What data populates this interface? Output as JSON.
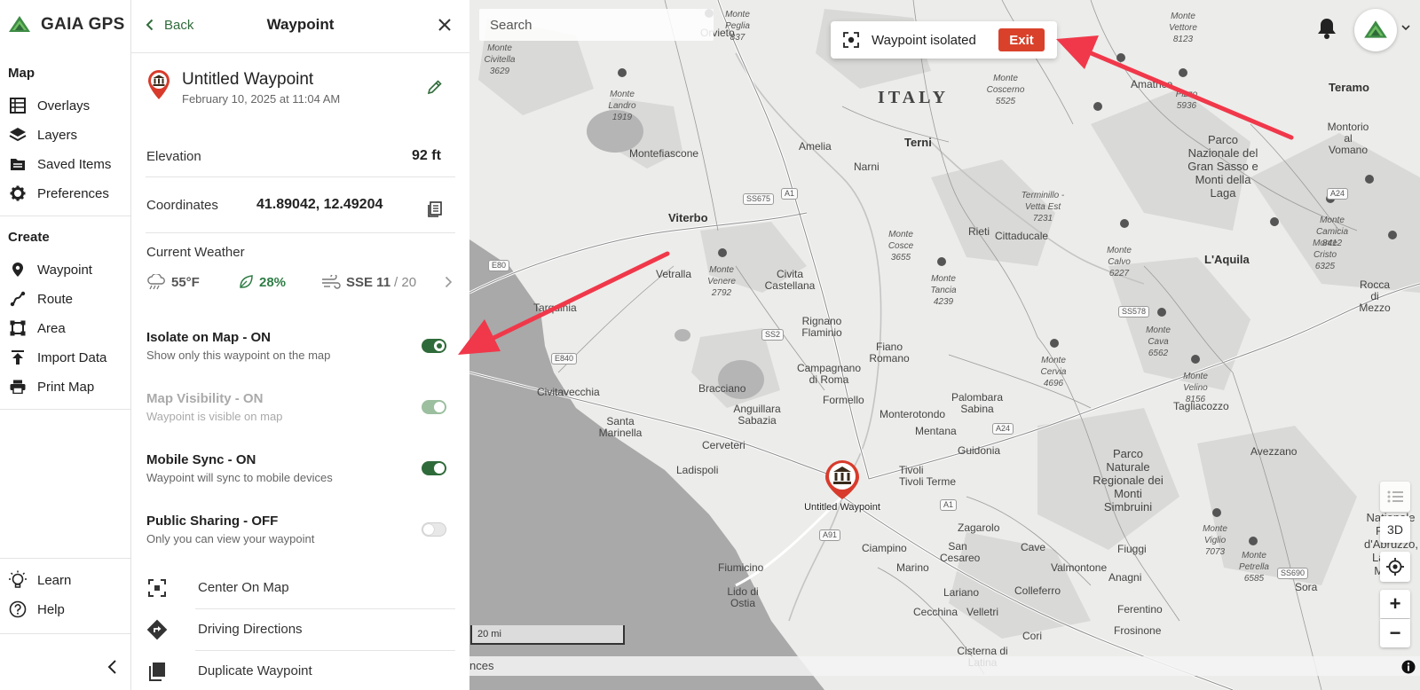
{
  "nav": {
    "brand": "GAIA GPS",
    "map_title": "Map",
    "map_items": [
      {
        "label": "Overlays",
        "icon": "overlays-icon"
      },
      {
        "label": "Layers",
        "icon": "layers-icon"
      },
      {
        "label": "Saved Items",
        "icon": "saved-items-icon"
      },
      {
        "label": "Preferences",
        "icon": "gear-icon"
      }
    ],
    "create_title": "Create",
    "create_items": [
      {
        "label": "Waypoint",
        "icon": "waypoint-pin-icon"
      },
      {
        "label": "Route",
        "icon": "route-icon"
      },
      {
        "label": "Area",
        "icon": "area-icon"
      },
      {
        "label": "Import Data",
        "icon": "upload-icon"
      },
      {
        "label": "Print Map",
        "icon": "printer-icon"
      }
    ],
    "bottom_items": [
      {
        "label": "Learn",
        "icon": "lightbulb-icon"
      },
      {
        "label": "Help",
        "icon": "help-icon"
      }
    ]
  },
  "panel": {
    "back_label": "Back",
    "title": "Waypoint",
    "waypoint_name": "Untitled Waypoint",
    "waypoint_date": "February 10, 2025 at 11:04 AM",
    "elevation_label": "Elevation",
    "elevation_value": "92 ft",
    "coordinates_label": "Coordinates",
    "coordinates_value": "41.89042, 12.49204",
    "weather_label": "Current Weather",
    "weather": {
      "temperature": "55°F",
      "humidity": "28%",
      "wind": "SSE 11",
      "gust": "/ 20"
    },
    "toggles": [
      {
        "title": "Isolate on Map - ON",
        "subtitle": "Show only this waypoint on the map",
        "state": "on"
      },
      {
        "title": "Map Visibility - ON",
        "subtitle": "Waypoint is visible on map",
        "state": "on-dim"
      },
      {
        "title": "Mobile Sync - ON",
        "subtitle": "Waypoint will sync to mobile devices",
        "state": "on"
      },
      {
        "title": "Public Sharing - OFF",
        "subtitle": "Only you can view your waypoint",
        "state": "off"
      }
    ],
    "actions": [
      {
        "label": "Center On Map",
        "icon": "center-focus-icon"
      },
      {
        "label": "Driving Directions",
        "icon": "directions-icon"
      },
      {
        "label": "Duplicate Waypoint",
        "icon": "duplicate-icon"
      }
    ]
  },
  "map": {
    "search_placeholder": "Search",
    "isolate_banner_text": "Waypoint isolated",
    "exit_label": "Exit",
    "btn_3d": "3D",
    "zoom_in": "+",
    "zoom_out": "−",
    "scale_label": "20 mi",
    "attribution": "nces",
    "marker_label": "Untitled Waypoint",
    "country_label": "ITALY",
    "cities": [
      {
        "name": "Terni"
      },
      {
        "name": "Viterbo"
      },
      {
        "name": "L'Aquila"
      },
      {
        "name": "Teramo"
      }
    ],
    "towns": [
      "Orvieto",
      "Montefiascone",
      "Amelia",
      "Narni",
      "Vetralla",
      "Civita Castellana",
      "Rieti",
      "Cittaducale",
      "Tarquinia",
      "Rignano Flaminio",
      "Campagnano di Roma",
      "Fiano Romano",
      "Civitavecchia",
      "Bracciano",
      "Anguillara Sabazia",
      "Formello",
      "Monterotondo",
      "Palombara Sabina",
      "Mentana",
      "Guidonia",
      "Tivoli",
      "Tivoli Terme",
      "Cerveteri",
      "Santa Marinella",
      "Ladispoli",
      "Fiumicino",
      "Lido di Ostia",
      "Ciampino",
      "Marino",
      "Zagarolo",
      "San Cesareo",
      "Cave",
      "Valmontone",
      "Fiuggi",
      "Anagni",
      "Colleferro",
      "Lariano",
      "Velletri",
      "Cecchina",
      "Ferentino",
      "Frosinone",
      "Cori",
      "Cisterna di Latina",
      "Avezzano",
      "Tagliacozzo",
      "Sora",
      "Amatrice",
      "Montorio al Vomano",
      "Rocca di Mezzo"
    ],
    "peaks": [
      {
        "name": "Monte Peglia",
        "elev": "837"
      },
      {
        "name": "Monte Civitella",
        "elev": "3629"
      },
      {
        "name": "Monte Landro",
        "elev": "1919"
      },
      {
        "name": "Monte Venere",
        "elev": "2792"
      },
      {
        "name": "Monte Cosce",
        "elev": "3655"
      },
      {
        "name": "Monte Tancia",
        "elev": "4239"
      },
      {
        "name": "Terminillo - Vetta Est",
        "elev": "7231"
      },
      {
        "name": "Monte Vettore",
        "elev": "8123"
      },
      {
        "name": "Monte Coscerno",
        "elev": "5525"
      },
      {
        "name": "Pizzo",
        "elev": "5936"
      },
      {
        "name": "Monte Calvo",
        "elev": "6227"
      },
      {
        "name": "Monte Cristo",
        "elev": "6325"
      },
      {
        "name": "Monte Camicia",
        "elev": "8412"
      },
      {
        "name": "Monte Cava",
        "elev": "6562"
      },
      {
        "name": "Monte Cervia",
        "elev": "4696"
      },
      {
        "name": "Monte Velino",
        "elev": "8156"
      },
      {
        "name": "Monte Viglio",
        "elev": "7073"
      },
      {
        "name": "Monte Petrella",
        "elev": "6585"
      }
    ],
    "parks": [
      "Parco Nazionale del Gran Sasso e Monti della Laga",
      "Parco Naturale Regionale dei Monti Simbruini",
      "Nationale Parco d'Abruzzo, Lazio e Molise"
    ],
    "roads": [
      "E80",
      "E840",
      "SS675",
      "A1",
      "SS2",
      "SS578",
      "A24",
      "A91",
      "SS690"
    ]
  },
  "colors": {
    "brand_green": "#2f6b3a",
    "exit_red": "#d9412b",
    "annotation_arrow": "#f0384a",
    "marker_red": "#d83b2b"
  }
}
